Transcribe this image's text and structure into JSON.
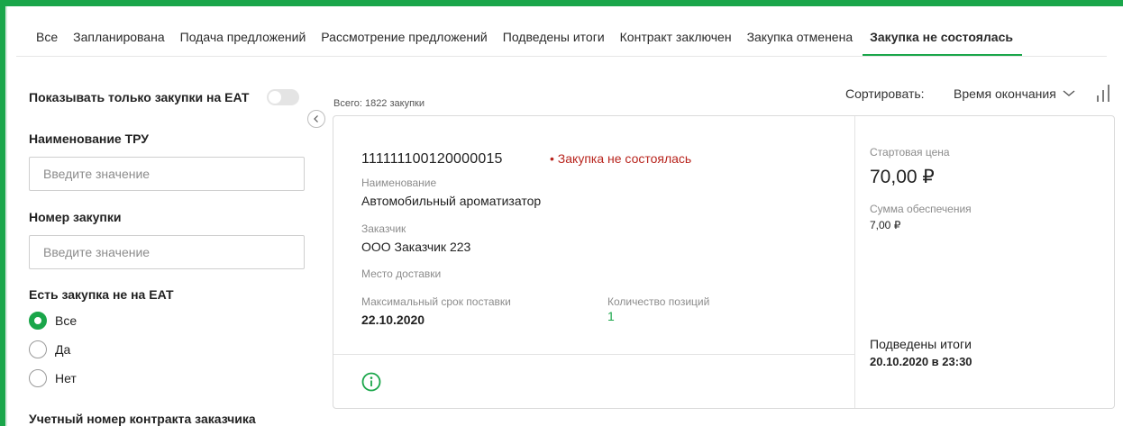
{
  "tabs": [
    {
      "label": "Все"
    },
    {
      "label": "Запланирована"
    },
    {
      "label": "Подача предложений"
    },
    {
      "label": "Рассмотрение предложений"
    },
    {
      "label": "Подведены итоги"
    },
    {
      "label": "Контракт заключен"
    },
    {
      "label": "Закупка отменена"
    },
    {
      "label": "Закупка не состоялась",
      "active": true
    }
  ],
  "sidebar": {
    "eat_toggle_label": "Показывать только закупки на ЕАТ",
    "tru_label": "Наименование ТРУ",
    "tru_placeholder": "Введите значение",
    "number_label": "Номер закупки",
    "number_placeholder": "Введите значение",
    "not_eat_label": "Есть закупка не на ЕАТ",
    "radios": [
      {
        "label": "Все",
        "checked": true
      },
      {
        "label": "Да",
        "checked": false
      },
      {
        "label": "Нет",
        "checked": false
      }
    ],
    "contract_label": "Учетный номер контракта заказчика"
  },
  "results": {
    "total": "Всего: 1822 закупки",
    "sort_label": "Сортировать:",
    "sort_value": "Время окончания"
  },
  "card": {
    "number": "111111100120000015",
    "status": "• Закупка не состоялась",
    "name_label": "Наименование",
    "name": "Автомобильный ароматизатор",
    "customer_label": "Заказчик",
    "customer": "ООО Заказчик 223",
    "delivery_label": "Место доставки",
    "max_term_label": "Максимальный срок поставки",
    "max_term": "22.10.2020",
    "positions_label": "Количество позиций",
    "positions": "1",
    "start_price_label": "Стартовая цена",
    "start_price": "70,00 ₽",
    "deposit_label": "Сумма обеспечения",
    "deposit": "7,00 ₽",
    "result_label": "Подведены итоги",
    "result_date": "20.10.2020 в 23:30"
  },
  "colors": {
    "accent": "#1aa64a",
    "status_red": "#b8241d"
  }
}
